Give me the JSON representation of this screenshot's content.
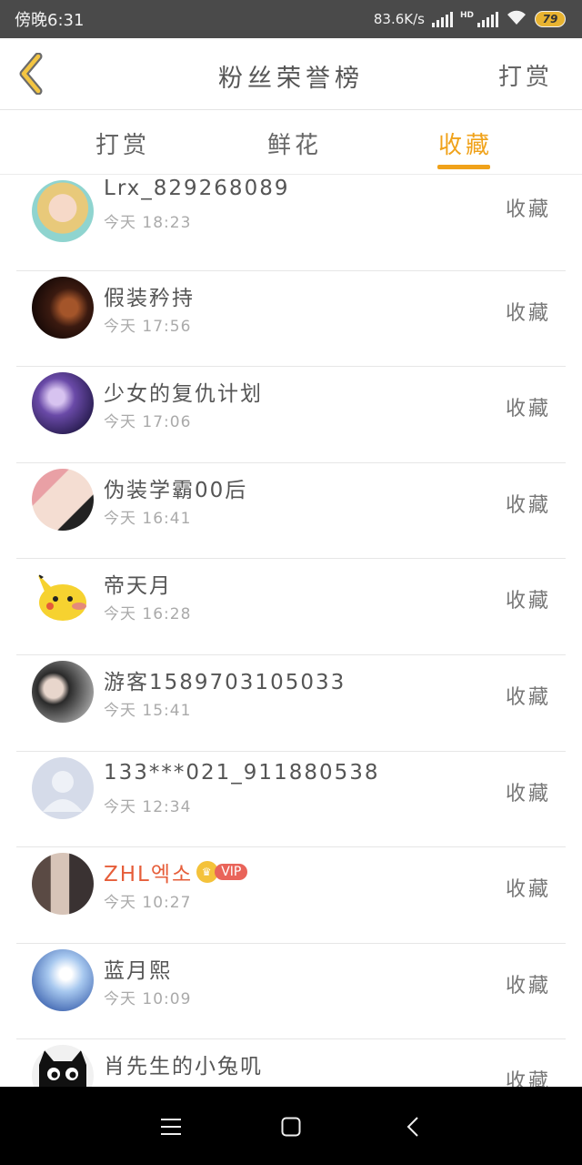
{
  "status": {
    "time": "傍晚6:31",
    "speed": "83.6K/s",
    "hd": "HD",
    "battery": "79"
  },
  "header": {
    "title": "粉丝荣誉榜",
    "right_action": "打赏"
  },
  "tabs": [
    {
      "label": "打赏"
    },
    {
      "label": "鲜花"
    },
    {
      "label": "收藏"
    }
  ],
  "active_tab": "收藏",
  "colors": {
    "accent": "#f0a21a",
    "vip_name": "#e65e3a",
    "status_bar": "#4a4a4a"
  },
  "users": [
    {
      "name": "Lrx_829268089",
      "time": "今天 18:23",
      "action": "收藏"
    },
    {
      "name": "假装矜持",
      "time": "今天 17:56",
      "action": "收藏"
    },
    {
      "name": "少女的复仇计划",
      "time": "今天 17:06",
      "action": "收藏"
    },
    {
      "name": "伪装学霸00后",
      "time": "今天 16:41",
      "action": "收藏"
    },
    {
      "name": "帝天月",
      "time": "今天 16:28",
      "action": "收藏"
    },
    {
      "name": "游客1589703105033",
      "time": "今天 15:41",
      "action": "收藏"
    },
    {
      "name": "133***021_911880538",
      "time": "今天 12:34",
      "action": "收藏"
    },
    {
      "name": "ZHL엑소",
      "time": "今天 10:27",
      "action": "收藏",
      "vip": "VIP"
    },
    {
      "name": "蓝月熙",
      "time": "今天 10:09",
      "action": "收藏"
    },
    {
      "name": "肖先生的小兔叽",
      "time": "",
      "action": "收藏"
    }
  ]
}
